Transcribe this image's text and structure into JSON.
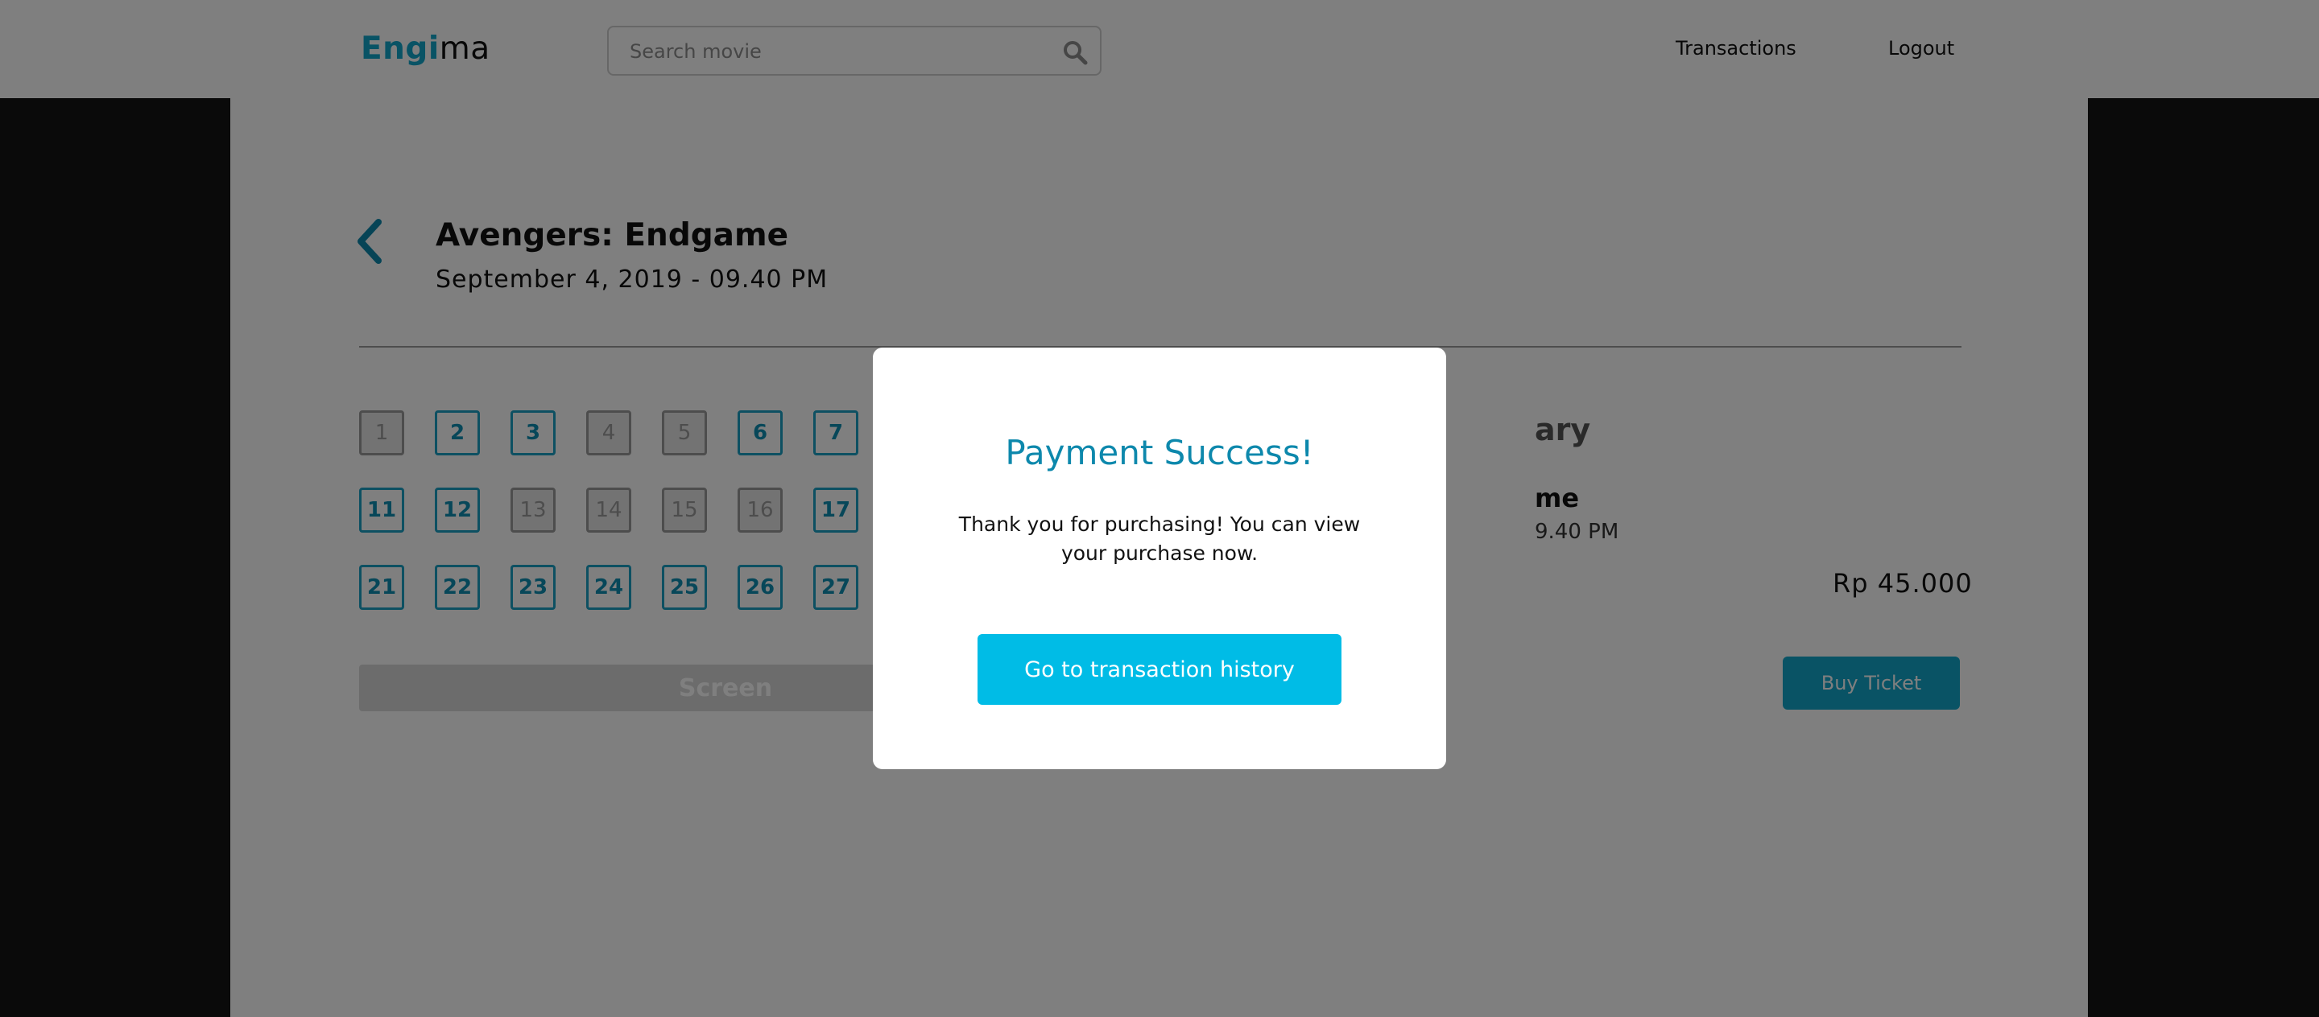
{
  "navbar": {
    "logo_accent": "Engi",
    "logo_rest": "ma",
    "search_placeholder": "Search movie",
    "search_icon": "search-icon",
    "links": {
      "transactions": "Transactions",
      "logout": "Logout"
    }
  },
  "movie": {
    "title": "Avengers: Endgame",
    "datetime": "September 4, 2019 - 09.40 PM"
  },
  "seats": {
    "rows": [
      [
        {
          "n": "1",
          "taken": true
        },
        {
          "n": "2",
          "taken": false
        },
        {
          "n": "3",
          "taken": false
        },
        {
          "n": "4",
          "taken": true
        },
        {
          "n": "5",
          "taken": true
        },
        {
          "n": "6",
          "taken": false
        },
        {
          "n": "7",
          "taken": false
        }
      ],
      [
        {
          "n": "11",
          "taken": false
        },
        {
          "n": "12",
          "taken": false
        },
        {
          "n": "13",
          "taken": true
        },
        {
          "n": "14",
          "taken": true
        },
        {
          "n": "15",
          "taken": true
        },
        {
          "n": "16",
          "taken": true
        },
        {
          "n": "17",
          "taken": false
        }
      ],
      [
        {
          "n": "21",
          "taken": false
        },
        {
          "n": "22",
          "taken": false
        },
        {
          "n": "23",
          "taken": false
        },
        {
          "n": "24",
          "taken": false
        },
        {
          "n": "25",
          "taken": false
        },
        {
          "n": "26",
          "taken": false
        },
        {
          "n": "27",
          "taken": false
        }
      ]
    ],
    "screen_label": "Screen"
  },
  "summary": {
    "title_partial": "ary",
    "movie_partial": "me",
    "time_partial": "9.40 PM",
    "price": "Rp 45.000",
    "buy_label": "Buy Ticket"
  },
  "modal": {
    "title": "Payment Success!",
    "text": "Thank you for purchasing! You can view your purchase now.",
    "button_label": "Go to transaction history"
  },
  "colors": {
    "accent": "#12a6cb",
    "modal_title": "#0d88ac",
    "modal_button": "#00bce6",
    "overlay": "rgba(0,0,0,0.5)"
  }
}
